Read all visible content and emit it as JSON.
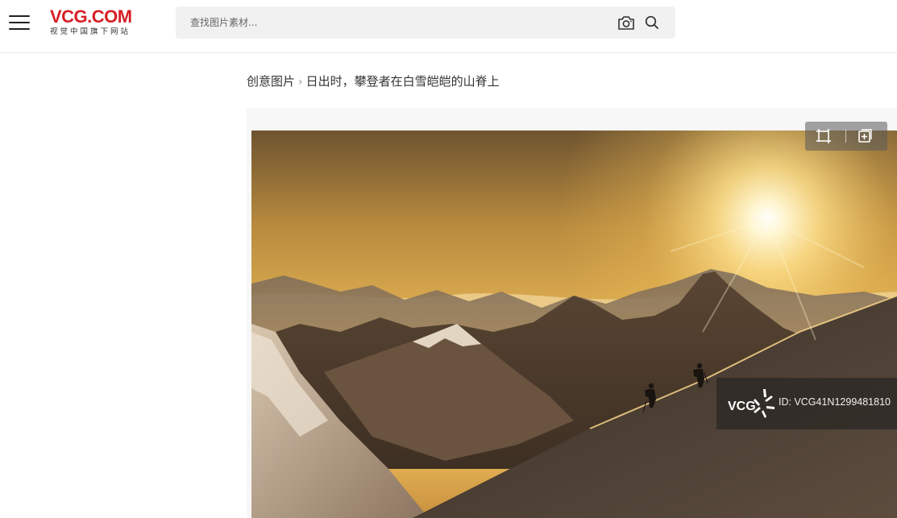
{
  "header": {
    "logo_text": "VCG.COM",
    "logo_subtitle": "视觉中国旗下网站",
    "search": {
      "placeholder": "查找图片素材..."
    },
    "icons": {
      "menu": "hamburger-menu-icon",
      "camera": "camera-search-icon",
      "search": "search-icon"
    }
  },
  "breadcrumb": {
    "items": [
      "创意图片",
      "日出时，攀登者在白雪皑皑的山脊上"
    ],
    "separator": "›"
  },
  "image_viewer": {
    "tools": [
      "crop-icon",
      "add-to-collection-icon"
    ],
    "watermark": {
      "logo_text": "VCG",
      "id_text": "ID: VCG41N1299481810"
    }
  },
  "colors": {
    "brand_red": "#d61f26",
    "search_bg": "#f1f1f1"
  }
}
